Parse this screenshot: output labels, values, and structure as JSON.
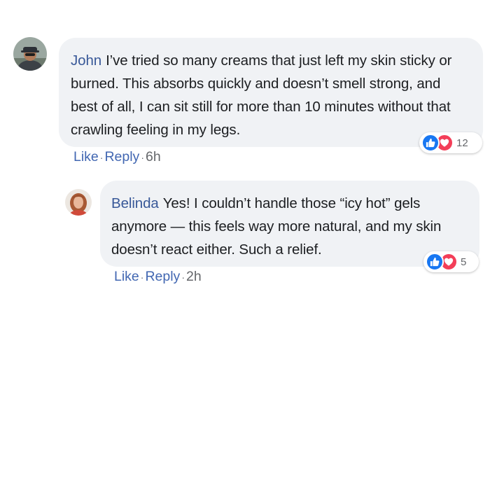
{
  "comments": [
    {
      "author": "John",
      "text": "I’ve tried so many creams that just left my skin sticky or burned. This absorbs quickly and doesn’t smell strong, and best of all, I can sit still for more than 10 minutes without that crawling feeling in my legs.",
      "reaction_count": "12",
      "like_label": "Like",
      "reply_label": "Reply",
      "separator": "·",
      "time": "6h"
    },
    {
      "author": "Belinda",
      "text": "Yes! I couldn’t handle those “icy hot” gels anymore — this feels way more natural, and my skin doesn’t react either. Such a relief.",
      "reaction_count": "5",
      "like_label": "Like",
      "reply_label": "Reply",
      "separator": "·",
      "time": "2h"
    }
  ],
  "colors": {
    "author_link": "#385898",
    "action_link": "#4267b2",
    "bubble_bg": "#f0f2f5",
    "like_blue": "#1877f2",
    "love_red": "#f33e58"
  },
  "icons": {
    "like": "thumbs-up-icon",
    "love": "heart-icon"
  }
}
